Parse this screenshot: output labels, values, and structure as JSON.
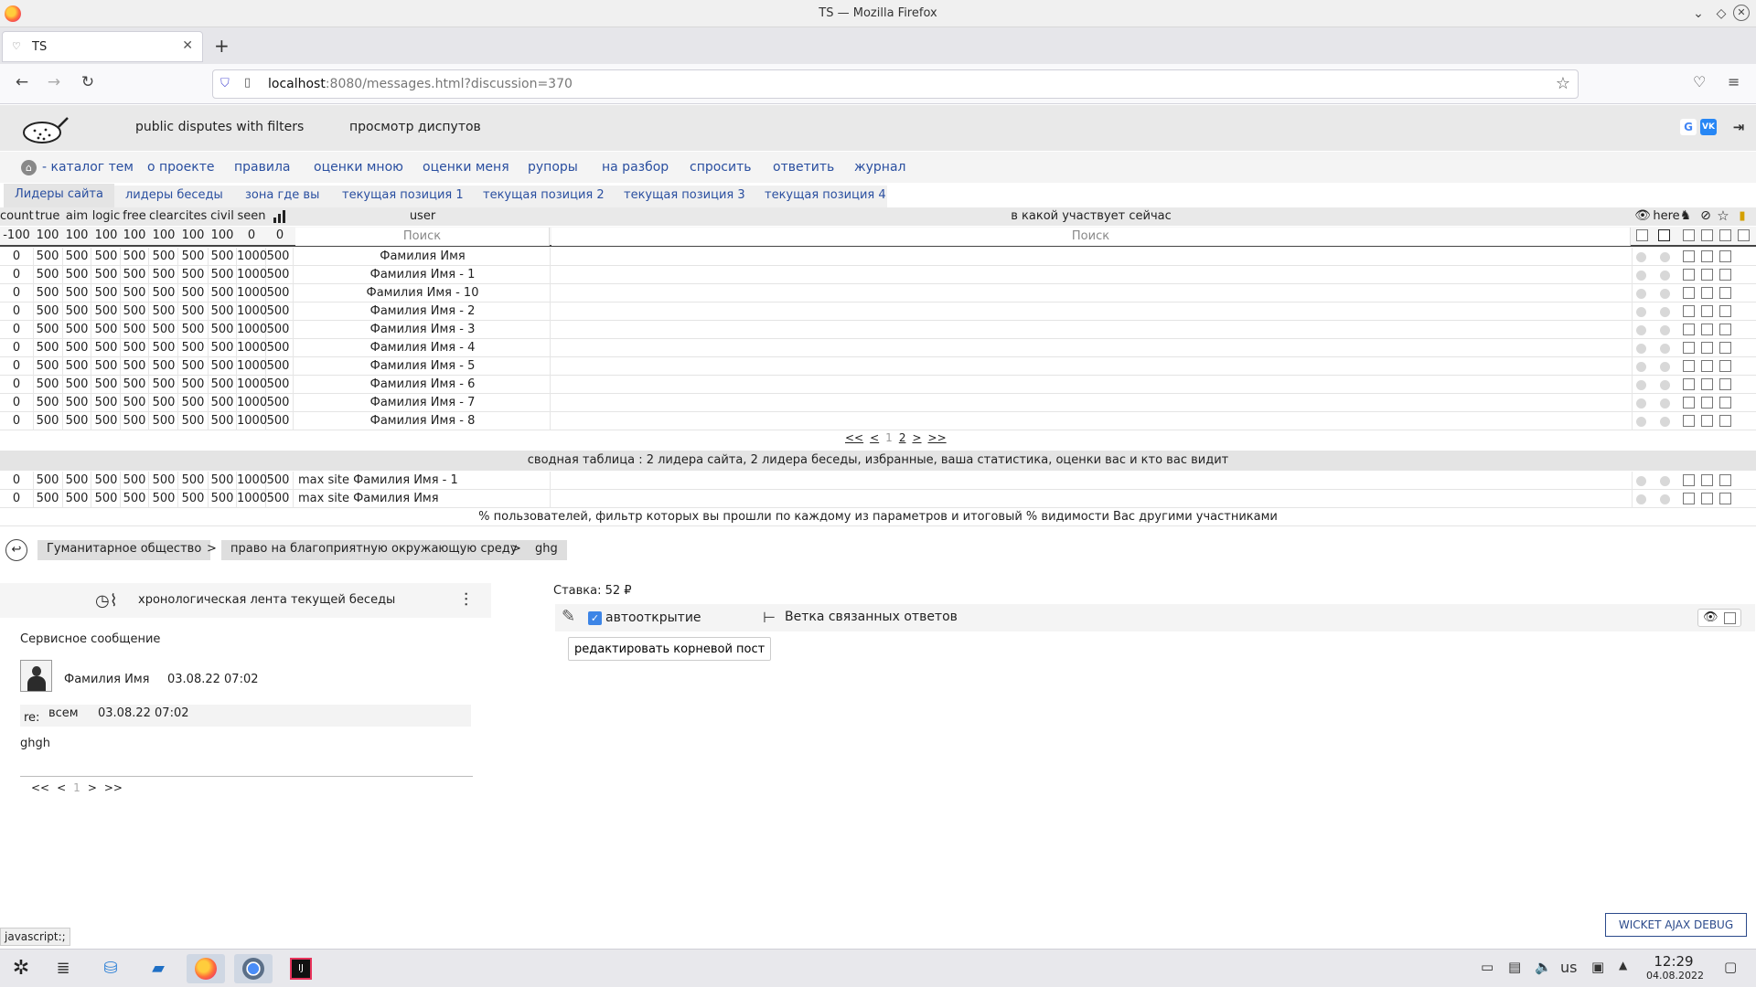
{
  "browser": {
    "window_title": "TS — Mozilla Firefox",
    "tab_title": "TS",
    "url_host": "localhost",
    "url_rest": ":8080/messages.html?discussion=370"
  },
  "site": {
    "header_links": [
      "public disputes with filters",
      "просмотр диспутов"
    ],
    "social": [
      "G",
      "VK"
    ],
    "menu": [
      "- каталог тем",
      "о проекте",
      "правила",
      "оценки мною",
      "оценки меня",
      "рупоры",
      "на разбор",
      "спросить",
      "ответить",
      "журнал"
    ],
    "subtabs": [
      "Лидеры сайта",
      "лидеры беседы",
      "зона где вы",
      "текущая позиция 1",
      "текущая позиция 2",
      "текущая позиция 3",
      "текущая позиция 4"
    ]
  },
  "leaders": {
    "columns": [
      "count",
      "true",
      "aim",
      "logic",
      "free",
      "clear",
      "cites",
      "civil",
      "seen"
    ],
    "user_header": "user",
    "current_header": "в какой участвует сейчас",
    "here_label": "here",
    "filter_values": [
      "-100",
      "100",
      "100",
      "100",
      "100",
      "100",
      "100",
      "100",
      "0",
      "0"
    ],
    "search_placeholder": "Поиск",
    "rows": [
      {
        "vals": [
          "0",
          "500",
          "500",
          "500",
          "500",
          "500",
          "500",
          "500",
          "1000",
          "500"
        ],
        "user": "Фамилия Имя"
      },
      {
        "vals": [
          "0",
          "500",
          "500",
          "500",
          "500",
          "500",
          "500",
          "500",
          "1000",
          "500"
        ],
        "user": "Фамилия Имя - 1"
      },
      {
        "vals": [
          "0",
          "500",
          "500",
          "500",
          "500",
          "500",
          "500",
          "500",
          "1000",
          "500"
        ],
        "user": "Фамилия Имя - 10"
      },
      {
        "vals": [
          "0",
          "500",
          "500",
          "500",
          "500",
          "500",
          "500",
          "500",
          "1000",
          "500"
        ],
        "user": "Фамилия Имя - 2"
      },
      {
        "vals": [
          "0",
          "500",
          "500",
          "500",
          "500",
          "500",
          "500",
          "500",
          "1000",
          "500"
        ],
        "user": "Фамилия Имя - 3"
      },
      {
        "vals": [
          "0",
          "500",
          "500",
          "500",
          "500",
          "500",
          "500",
          "500",
          "1000",
          "500"
        ],
        "user": "Фамилия Имя - 4"
      },
      {
        "vals": [
          "0",
          "500",
          "500",
          "500",
          "500",
          "500",
          "500",
          "500",
          "1000",
          "500"
        ],
        "user": "Фамилия Имя - 5"
      },
      {
        "vals": [
          "0",
          "500",
          "500",
          "500",
          "500",
          "500",
          "500",
          "500",
          "1000",
          "500"
        ],
        "user": "Фамилия Имя - 6"
      },
      {
        "vals": [
          "0",
          "500",
          "500",
          "500",
          "500",
          "500",
          "500",
          "500",
          "1000",
          "500"
        ],
        "user": "Фамилия Имя - 7"
      },
      {
        "vals": [
          "0",
          "500",
          "500",
          "500",
          "500",
          "500",
          "500",
          "500",
          "1000",
          "500"
        ],
        "user": "Фамилия Имя - 8"
      }
    ],
    "pager": [
      "<<",
      "<",
      "1",
      "2",
      ">",
      ">>"
    ],
    "summary": "сводная таблица : 2 лидера сайта, 2 лидера беседы, избранные, ваша статистика, оценки вас и кто вас видит",
    "summary_rows": [
      {
        "vals": [
          "0",
          "500",
          "500",
          "500",
          "500",
          "500",
          "500",
          "500",
          "1000",
          "500"
        ],
        "user": "max site Фамилия Имя - 1"
      },
      {
        "vals": [
          "0",
          "500",
          "500",
          "500",
          "500",
          "500",
          "500",
          "500",
          "1000",
          "500"
        ],
        "user": "max site Фамилия Имя"
      }
    ],
    "footnote": "% пользователей, фильтр которых вы прошли по каждому из параметров и итоговый % видимости Вас другими участниками"
  },
  "breadcrumb": [
    "Гуманитарное общество",
    "право на благоприятную окружающую среду",
    "ghg"
  ],
  "feed": {
    "header": "хронологическая лента текущей беседы",
    "service_message": "Сервисное сообщение",
    "author": "Фамилия Имя",
    "date": "03.08.22 07:02",
    "re_label": "re:",
    "re_to": "всем",
    "re_date": "03.08.22 07:02",
    "body": "ghgh",
    "pager": [
      "<<",
      "<",
      "1",
      ">",
      ">>"
    ]
  },
  "right": {
    "stake": "Ставка: 52 ₽",
    "autoopen": "автооткрытие",
    "branch": "Ветка связанных ответов",
    "edit_root": "редактировать корневой пост"
  },
  "status_text": "javascript:;",
  "wicket_debug": "WICKET AJAX DEBUG",
  "taskbar": {
    "lang": "us",
    "time": "12:29",
    "date": "04.08.2022"
  },
  "colors": {
    "link": "#2a4fa0",
    "checkbox_accent": "#3d85e6"
  }
}
